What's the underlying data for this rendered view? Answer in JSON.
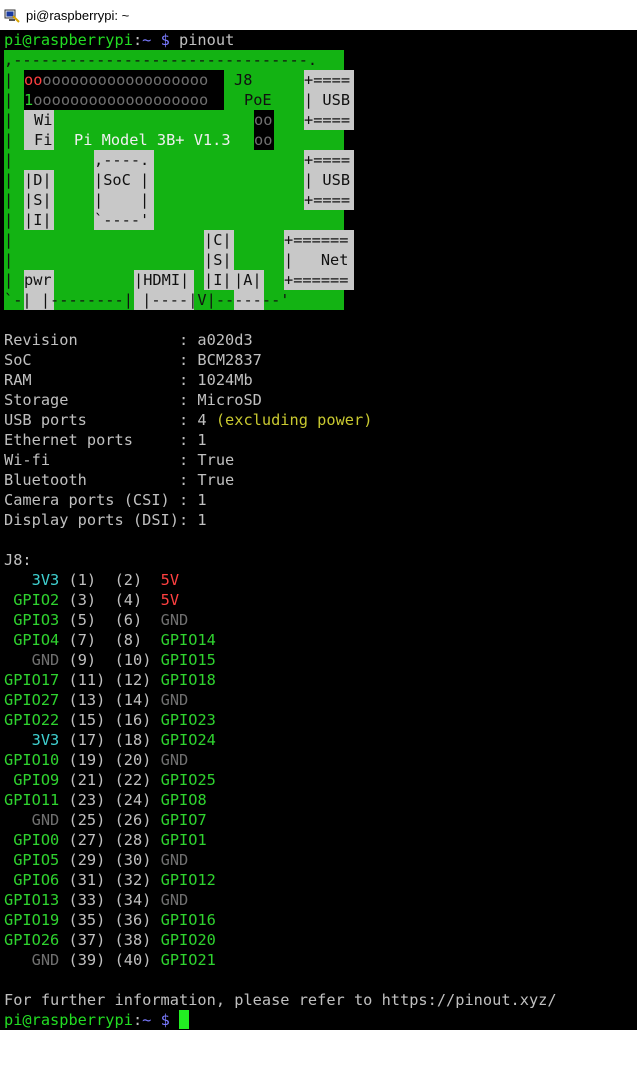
{
  "window": {
    "title": "pi@raspberrypi: ~"
  },
  "prompt": {
    "user_host": "pi@raspberrypi",
    "sep": ":",
    "path": "~",
    "dollar": " $ ",
    "command": "pinout"
  },
  "board": {
    "top_border": ",--------------------------------.",
    "bottom_border": "`-| |--------| |----|V|-------'",
    "header_row1": "oooooooooooooooooooo",
    "header_row2": "1ooooooooooooooooooo",
    "j8": "J8",
    "poe": "PoE",
    "poe_pins": "oo",
    "usb_top": "+====",
    "usb_label": "| USB",
    "wifi": "Wi\nFi",
    "model": "Pi Model 3B+ V1.3",
    "soc_top": ",----.",
    "soc_label": "|SoC |",
    "soc_mid": "|    |",
    "soc_bot": "`----'",
    "dsi": "|D|\n|S|\n|I|",
    "csi": "|C|\n|S|\n|I|",
    "net_top": "+======",
    "net_label": "|   Net",
    "pwr": "pwr",
    "hdmi": "|HDMI|",
    "audio": "|A|",
    "left_bar": "|"
  },
  "info": [
    {
      "key": "Revision           ",
      "value": "a020d3",
      "extra": ""
    },
    {
      "key": "SoC                ",
      "value": "BCM2837",
      "extra": ""
    },
    {
      "key": "RAM                ",
      "value": "1024Mb",
      "extra": ""
    },
    {
      "key": "Storage            ",
      "value": "MicroSD",
      "extra": ""
    },
    {
      "key": "USB ports          ",
      "value": "4",
      "extra": "(excluding power)"
    },
    {
      "key": "Ethernet ports     ",
      "value": "1",
      "extra": ""
    },
    {
      "key": "Wi-fi              ",
      "value": "True",
      "extra": ""
    },
    {
      "key": "Bluetooth          ",
      "value": "True",
      "extra": ""
    },
    {
      "key": "Camera ports (CSI) ",
      "value": "1",
      "extra": ""
    },
    {
      "key": "Display ports (DSI)",
      "value": "1",
      "extra": ""
    }
  ],
  "j8_label": "J8:",
  "pins": [
    {
      "l": "3V3",
      "lc": "c",
      "ln": "(1)",
      "rn": "(2)",
      "r": "5V",
      "rc": "r"
    },
    {
      "l": "GPIO2",
      "lc": "g",
      "ln": "(3)",
      "rn": "(4)",
      "r": "5V",
      "rc": "r"
    },
    {
      "l": "GPIO3",
      "lc": "g",
      "ln": "(5)",
      "rn": "(6)",
      "r": "GND",
      "rc": "d"
    },
    {
      "l": "GPIO4",
      "lc": "g",
      "ln": "(7)",
      "rn": "(8)",
      "r": "GPIO14",
      "rc": "g"
    },
    {
      "l": "GND",
      "lc": "d",
      "ln": "(9)",
      "rn": "(10)",
      "r": "GPIO15",
      "rc": "g"
    },
    {
      "l": "GPIO17",
      "lc": "g",
      "ln": "(11)",
      "rn": "(12)",
      "r": "GPIO18",
      "rc": "g"
    },
    {
      "l": "GPIO27",
      "lc": "g",
      "ln": "(13)",
      "rn": "(14)",
      "r": "GND",
      "rc": "d"
    },
    {
      "l": "GPIO22",
      "lc": "g",
      "ln": "(15)",
      "rn": "(16)",
      "r": "GPIO23",
      "rc": "g"
    },
    {
      "l": "3V3",
      "lc": "c",
      "ln": "(17)",
      "rn": "(18)",
      "r": "GPIO24",
      "rc": "g"
    },
    {
      "l": "GPIO10",
      "lc": "g",
      "ln": "(19)",
      "rn": "(20)",
      "r": "GND",
      "rc": "d"
    },
    {
      "l": "GPIO9",
      "lc": "g",
      "ln": "(21)",
      "rn": "(22)",
      "r": "GPIO25",
      "rc": "g"
    },
    {
      "l": "GPIO11",
      "lc": "g",
      "ln": "(23)",
      "rn": "(24)",
      "r": "GPIO8",
      "rc": "g"
    },
    {
      "l": "GND",
      "lc": "d",
      "ln": "(25)",
      "rn": "(26)",
      "r": "GPIO7",
      "rc": "g"
    },
    {
      "l": "GPIO0",
      "lc": "g",
      "ln": "(27)",
      "rn": "(28)",
      "r": "GPIO1",
      "rc": "g"
    },
    {
      "l": "GPIO5",
      "lc": "g",
      "ln": "(29)",
      "rn": "(30)",
      "r": "GND",
      "rc": "d"
    },
    {
      "l": "GPIO6",
      "lc": "g",
      "ln": "(31)",
      "rn": "(32)",
      "r": "GPIO12",
      "rc": "g"
    },
    {
      "l": "GPIO13",
      "lc": "g",
      "ln": "(33)",
      "rn": "(34)",
      "r": "GND",
      "rc": "d"
    },
    {
      "l": "GPIO19",
      "lc": "g",
      "ln": "(35)",
      "rn": "(36)",
      "r": "GPIO16",
      "rc": "g"
    },
    {
      "l": "GPIO26",
      "lc": "g",
      "ln": "(37)",
      "rn": "(38)",
      "r": "GPIO20",
      "rc": "g"
    },
    {
      "l": "GND",
      "lc": "d",
      "ln": "(39)",
      "rn": "(40)",
      "r": "GPIO21",
      "rc": "g"
    }
  ],
  "footer": "For further information, please refer to https://pinout.xyz/",
  "colors": {
    "background": "#000000",
    "board_green": "#13b313",
    "prompt_green": "#22dd22",
    "path_blue": "#7a7aff"
  }
}
